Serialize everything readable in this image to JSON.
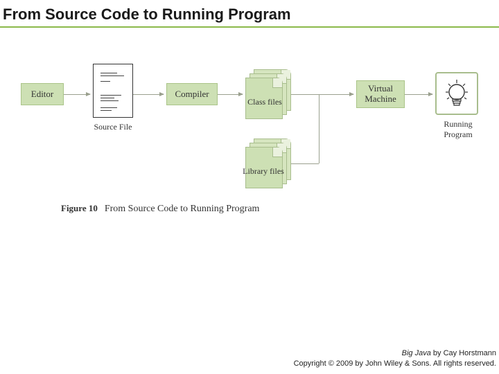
{
  "title": "From Source Code to Running Program",
  "nodes": {
    "editor": "Editor",
    "source_file": "Source File",
    "compiler": "Compiler",
    "class_files": "Class files",
    "library_files": "Library files",
    "virtual_machine": "Virtual\nMachine",
    "running_program": "Running\nProgram"
  },
  "figure": {
    "label": "Figure 10",
    "caption": "From Source Code to Running Program"
  },
  "footer": {
    "book": "Big Java",
    "byline": " by Cay Horstmann",
    "copyright": "Copyright © 2009 by John Wiley & Sons.  All rights reserved."
  }
}
